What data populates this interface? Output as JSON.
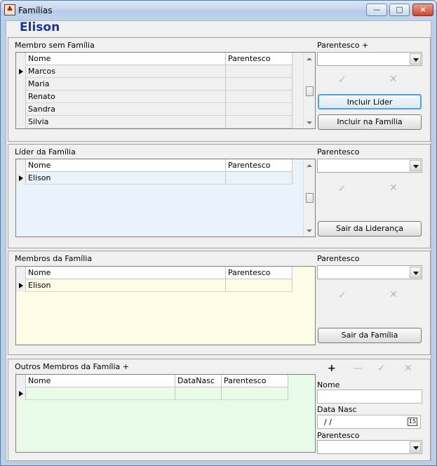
{
  "window": {
    "title": "Famílias",
    "app_icon": "family-app-icon",
    "minimize_icon": "minimize-icon",
    "maximize_icon": "maximize-icon",
    "close_icon": "close-icon"
  },
  "person_name": "Elison",
  "membro_sem_familia": {
    "title": "Membro sem Família",
    "headers": [
      "Nome",
      "Parentesco"
    ],
    "rows": [
      [
        "Marcos",
        ""
      ],
      [
        "Maria",
        ""
      ],
      [
        "Renato",
        ""
      ],
      [
        "Sandra",
        ""
      ],
      [
        "Silvia",
        ""
      ]
    ],
    "parentesco_label": "Parentesco +",
    "confirm_icon": "check-icon",
    "cancel_icon": "x-icon",
    "primary_button": "Incluir Líder",
    "secondary_button": "Incluir na Família"
  },
  "lider_familia": {
    "title": "Líder da Família",
    "headers": [
      "Nome",
      "Parentesco"
    ],
    "rows": [
      [
        "Elison",
        ""
      ]
    ],
    "parentesco_label": "Parentesco",
    "confirm_icon": "check-icon",
    "cancel_icon": "x-icon",
    "button": "Sair da Liderança",
    "background_color": "#eaf3fc"
  },
  "membros_familia": {
    "title": "Membros da Família",
    "headers": [
      "Nome",
      "Parentesco"
    ],
    "rows": [
      [
        "Elison",
        ""
      ]
    ],
    "parentesco_label": "Parentesco",
    "confirm_icon": "check-icon",
    "cancel_icon": "x-icon",
    "button": "Sair da Família",
    "background_color": "#fffde8"
  },
  "outros_membros": {
    "title": "Outros Membros da Família +",
    "headers": [
      "Nome",
      "DataNasc",
      "Parentesco"
    ],
    "rows": [
      [
        "",
        "",
        ""
      ]
    ],
    "add_icon": "plus-icon",
    "remove_icon": "minus-icon",
    "confirm_icon": "check-icon",
    "cancel_icon": "x-icon",
    "name_label": "Nome",
    "date_label": "Data Nasc",
    "date_value": "/ /",
    "calendar_icon": "calendar-icon",
    "calendar_text": "15",
    "parentesco_label": "Parentesco",
    "background_color": "#e8fbe8"
  }
}
